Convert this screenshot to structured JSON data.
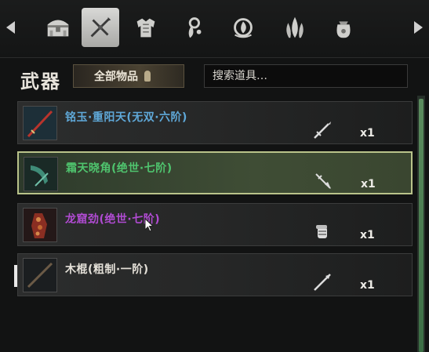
{
  "tabs": [
    {
      "icon": "chest-icon",
      "active": false
    },
    {
      "icon": "crossed-weapons-icon",
      "active": true
    },
    {
      "icon": "armor-icon",
      "active": false
    },
    {
      "icon": "pendant-icon",
      "active": false
    },
    {
      "icon": "relic-icon",
      "active": false
    },
    {
      "icon": "herb-icon",
      "active": false
    },
    {
      "icon": "pouch-icon",
      "active": false
    }
  ],
  "header": {
    "category": "武器",
    "filter_label": "全部物品",
    "search_placeholder": "搜索道具…"
  },
  "items": [
    {
      "name": "铭玉·重阳天(无双·六阶)",
      "name_color": "#5fa8d8",
      "quantity": "x1",
      "type_icon": "sword-icon",
      "selected": false
    },
    {
      "name": "霜天晓角(绝世·七阶)",
      "name_color": "#4fc46e",
      "quantity": "x1",
      "type_icon": "spear-icon",
      "selected": true
    },
    {
      "name": "龙窟劲(绝世·七阶)",
      "name_color": "#b04bd2",
      "name_suffix_color": "#e4e0d8",
      "quantity": "x1",
      "type_icon": "gauntlet-icon",
      "selected": false
    },
    {
      "name": "木棍(粗制·一阶)",
      "name_color": "#e4e0d8",
      "quantity": "x1",
      "type_icon": "staff-icon",
      "selected": false
    }
  ]
}
